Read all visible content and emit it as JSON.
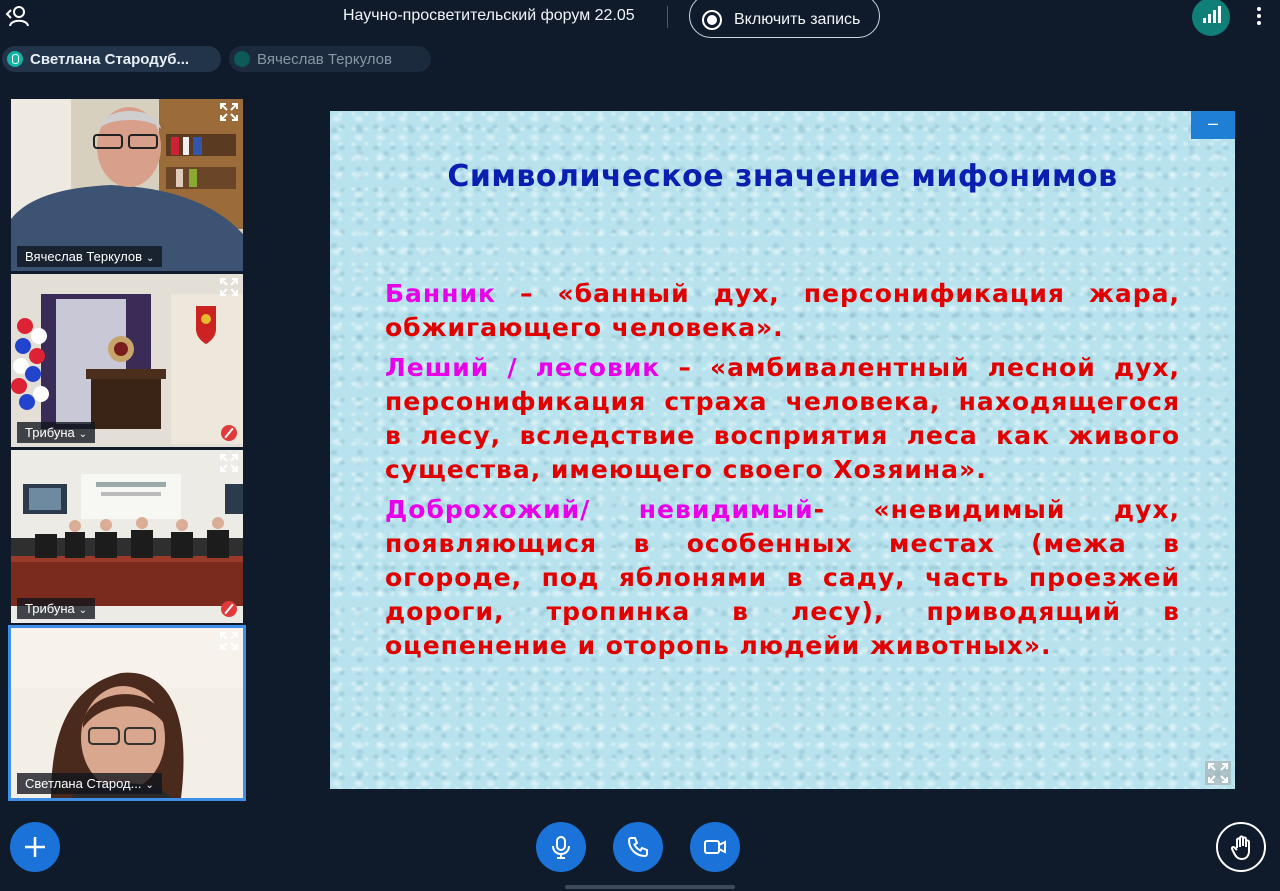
{
  "topbar": {
    "meeting_title": "Научно-просветительский форум 22.05",
    "record_label": "Включить запись",
    "icons": [
      "leave-icon",
      "record-icon",
      "signal-icon",
      "more-icon"
    ]
  },
  "speakers": [
    {
      "name": "Светлана Стародуб...",
      "active": true
    },
    {
      "name": "Вячеслав Теркулов",
      "active": false
    }
  ],
  "participants": [
    {
      "name": "Вячеслав Теркулов",
      "muted": false
    },
    {
      "name": "Трибуна",
      "muted": true
    },
    {
      "name": "Трибуна",
      "muted": true
    },
    {
      "name": "Светлана Старод...",
      "muted": false,
      "active": true
    }
  ],
  "slide": {
    "title": "Символическое значение мифонимов",
    "entries": [
      {
        "term": "Банник",
        "rest": " – «банный дух, персонификация жара, обжигающего человека»."
      },
      {
        "term": "Леший / лесовик",
        "rest": " – «амбивалентный лесной дух, персонификация страха человека, находящегося в лесу, вследствие восприятия леса как живого существа, имеющего своего Хозяина»."
      },
      {
        "term": "Доброхожий/ невидимый",
        "rest": "-  «невидимый дух, появляющися в особенных местах (межа в огороде, под яблонями в саду, часть проезжей дороги, тропинка в лесу), приводящий в оцепенение и оторопь людейи животных»."
      }
    ],
    "minimize_label": "–"
  },
  "controls": {
    "icons": [
      "add-icon",
      "microphone-icon",
      "phone-icon",
      "camera-icon",
      "raise-hand-icon"
    ]
  },
  "colors": {
    "background": "#0f1b2a",
    "accent": "#1b73d9",
    "slide_title": "#0a1fb0",
    "slide_text": "#e00000",
    "slide_term": "#e800e8"
  }
}
